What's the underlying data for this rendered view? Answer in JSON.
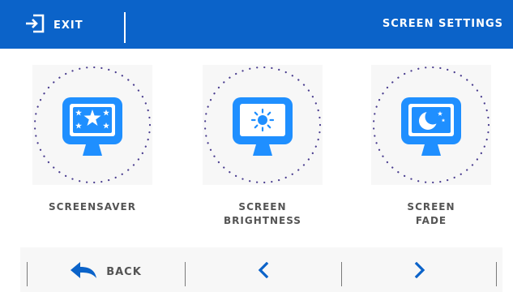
{
  "header": {
    "exit_label": "EXIT",
    "title": "SCREEN SETTINGS"
  },
  "tiles": [
    {
      "label": "SCREENSAVER",
      "icon": "monitor-stars-icon"
    },
    {
      "label": "SCREEN\nBRIGHTNESS",
      "icon": "monitor-sun-icon"
    },
    {
      "label": "SCREEN\nFADE",
      "icon": "monitor-moon-icon"
    }
  ],
  "footer": {
    "back_label": "BACK",
    "prev_icon": "chevron-left-icon",
    "next_icon": "chevron-right-icon"
  },
  "colors": {
    "accent": "#0b63c9",
    "icon_blue": "#1f8fff",
    "text_gray": "#545454",
    "dot_purple": "#4a3d8f",
    "tile_bg": "#f7f7f7"
  }
}
